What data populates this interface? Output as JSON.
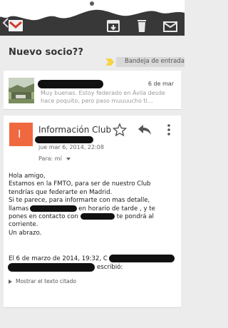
{
  "subject": "Nuevo socio??",
  "label": "Bandeja de entrada",
  "first_message": {
    "date": "6 de mar",
    "snippet": "Muy buenas. Estoy federado en Ávila desde hace poquito, pero paso muuuucho ti…"
  },
  "message": {
    "avatar_letter": "I",
    "sender": "Información Club",
    "sent_date": "jue mar 6, 2014, 22:08",
    "recipient": "Para: mí",
    "body_lines": [
      "Hola amigo,",
      "Estamos en la FMTO, para ser de nuestro Club",
      "tendrías que federarte en Madrid.",
      "Si te parece, para informarte con mas detalle,",
      "llamas",
      "en horario de tarde , y te",
      "pones en contacto con",
      "te pondrá al",
      "corriente.",
      "Un abrazo."
    ],
    "quote_header": "El 6 de marzo de 2014, 19:32, C",
    "quote_header_end": "escribió:",
    "show_quoted": "Mostrar el texto citado"
  },
  "colors": {
    "actionbar": "#383838",
    "avatar": "#f0683f",
    "important": "#f5d442"
  },
  "icons": [
    "back-arrow-icon",
    "gmail-logo-icon",
    "archive-icon",
    "trash-icon",
    "mail-icon",
    "important-marker-icon",
    "star-icon",
    "reply-icon",
    "more-vert-icon",
    "expand-triangle-icon"
  ]
}
